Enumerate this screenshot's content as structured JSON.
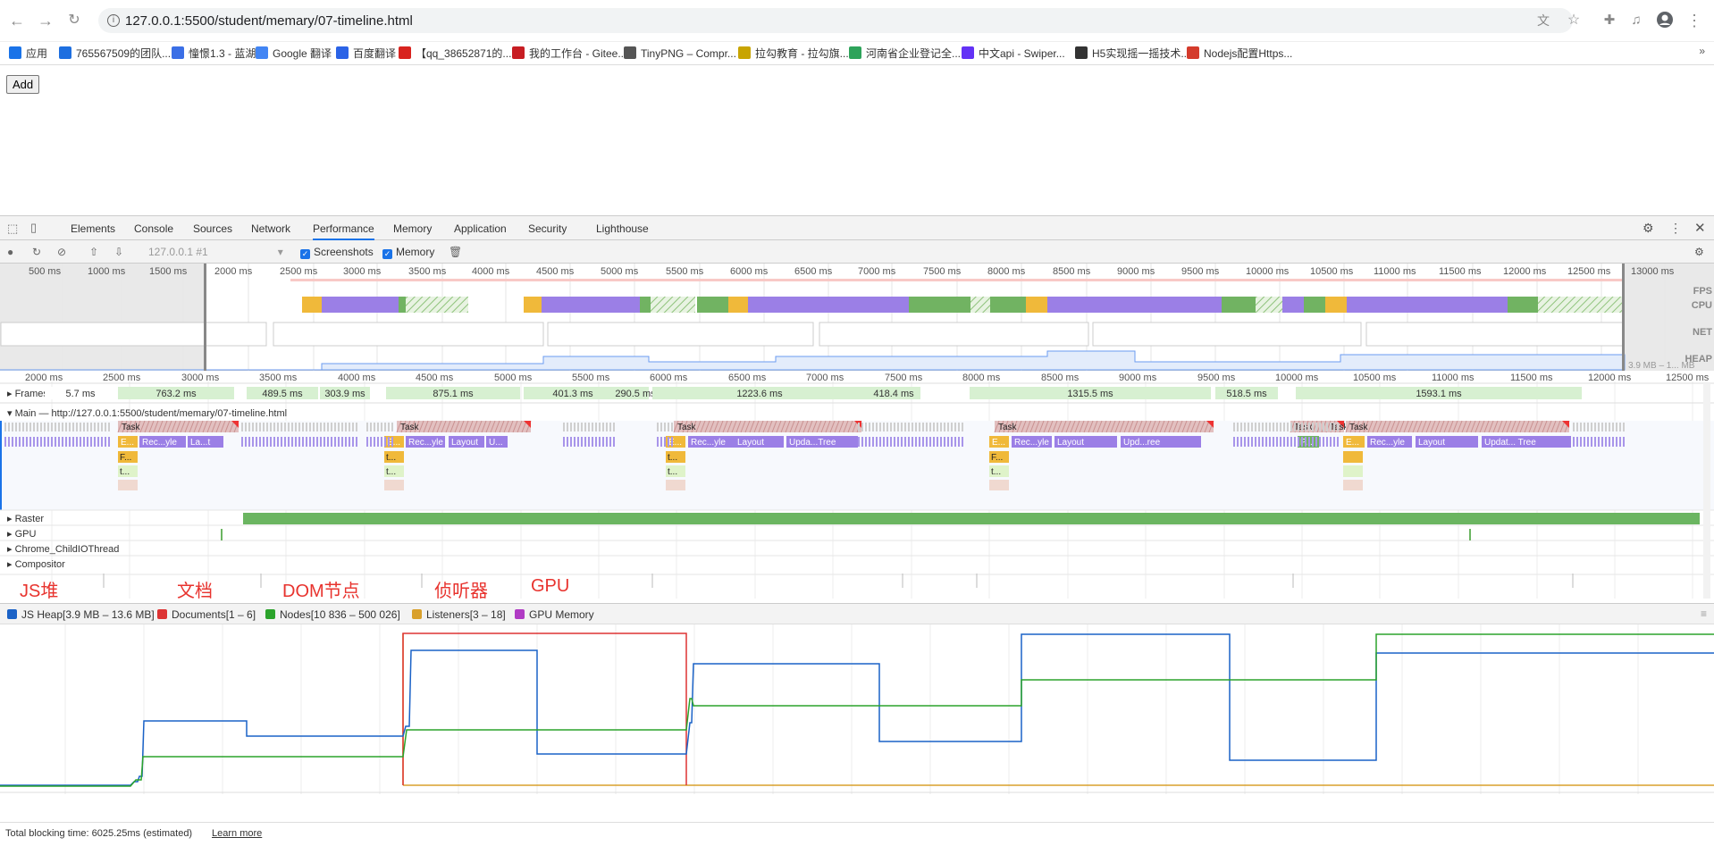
{
  "browser": {
    "url": "127.0.0.1:5500/student/memary/07-timeline.html",
    "bookmarks": [
      {
        "label": "应用",
        "color": "#1a73e8"
      },
      {
        "label": "765567509的团队...",
        "color": "#1e6fe0"
      },
      {
        "label": "憧憬1.3 - 蓝湖",
        "color": "#3b6fe6"
      },
      {
        "label": "Google 翻译",
        "color": "#4285f4"
      },
      {
        "label": "百度翻译",
        "color": "#2b63e6"
      },
      {
        "label": "【qq_38652871的...",
        "color": "#d8231f"
      },
      {
        "label": "我的工作台 - Gitee...",
        "color": "#c71d23"
      },
      {
        "label": "TinyPNG – Compr...",
        "color": "#555555"
      },
      {
        "label": "拉勾教育 - 拉勾旗...",
        "color": "#c8a400"
      },
      {
        "label": "河南省企业登记全...",
        "color": "#2ea35a"
      },
      {
        "label": "中文api - Swiper...",
        "color": "#6332f6"
      },
      {
        "label": "H5实现摇一摇技术...",
        "color": "#333333"
      },
      {
        "label": "Nodejs配置Https...",
        "color": "#d43b2c"
      }
    ]
  },
  "page": {
    "add_button": "Add"
  },
  "devtools": {
    "tabs": [
      "Elements",
      "Console",
      "Sources",
      "Network",
      "Performance",
      "Memory",
      "Application",
      "Security",
      "Lighthouse"
    ],
    "active_tab": "Performance",
    "recording_select": "127.0.0.1 #1",
    "screenshots_label": "Screenshots",
    "memory_label": "Memory"
  },
  "overview": {
    "ticks": [
      "500 ms",
      "1000 ms",
      "1500 ms",
      "2000 ms",
      "2500 ms",
      "3000 ms",
      "3500 ms",
      "4000 ms",
      "4500 ms",
      "5000 ms",
      "5500 ms",
      "6000 ms",
      "6500 ms",
      "7000 ms",
      "7500 ms",
      "8000 ms",
      "8500 ms",
      "9000 ms",
      "9500 ms",
      "10000 ms",
      "10500 ms",
      "11000 ms",
      "11500 ms",
      "12000 ms",
      "12500 ms",
      "13000 ms"
    ],
    "lanes": [
      "FPS",
      "CPU",
      "NET",
      "HEAP"
    ],
    "heap_range": "3.9 MB – 1... MB"
  },
  "timeline": {
    "ticks": [
      "2000 ms",
      "2500 ms",
      "3000 ms",
      "3500 ms",
      "4000 ms",
      "4500 ms",
      "5000 ms",
      "5500 ms",
      "6000 ms",
      "6500 ms",
      "7000 ms",
      "7500 ms",
      "8000 ms",
      "8500 ms",
      "9000 ms",
      "9500 ms",
      "10000 ms",
      "10500 ms",
      "11000 ms",
      "11500 ms",
      "12000 ms",
      "12500 ms"
    ],
    "frames_label": "Frames",
    "frames": [
      "5.7 ms",
      "763.2 ms",
      "489.5 ms",
      "303.9 ms",
      "875.1 ms",
      "401.3 ms",
      "290.5 ms",
      "1223.6 ms",
      "418.4 ms",
      "1315.5 ms",
      "518.5 ms",
      "1593.1 ms"
    ],
    "main_label": "Main — http://127.0.0.1:5500/student/memary/07-timeline.html",
    "task_labels": [
      "Task",
      "Rec...yle",
      "La...t",
      "Layout",
      "U...",
      "Upda...Tree",
      "Upd...ree",
      "Updat... Tree",
      "E...",
      "F...",
      "t...",
      "P..."
    ],
    "tracks": [
      "Raster",
      "GPU",
      "Chrome_ChildIOThread",
      "Compositor"
    ]
  },
  "annotations": [
    "JS堆",
    "文档",
    "DOM节点",
    "侦听器",
    "GPU"
  ],
  "memory": {
    "legend": [
      {
        "label": "JS Heap[3.9 MB – 13.6 MB]",
        "color": "#1a62c7"
      },
      {
        "label": "Documents[1 – 6]",
        "color": "#d33"
      },
      {
        "label": "Nodes[10 836 – 500 026]",
        "color": "#2ba32b"
      },
      {
        "label": "Listeners[3 – 18]",
        "color": "#d9a02b"
      },
      {
        "label": "GPU Memory",
        "color": "#b03bc4"
      }
    ]
  },
  "footer": {
    "blocking": "Total blocking time: 6025.25ms (estimated)",
    "learn_more": "Learn more"
  }
}
